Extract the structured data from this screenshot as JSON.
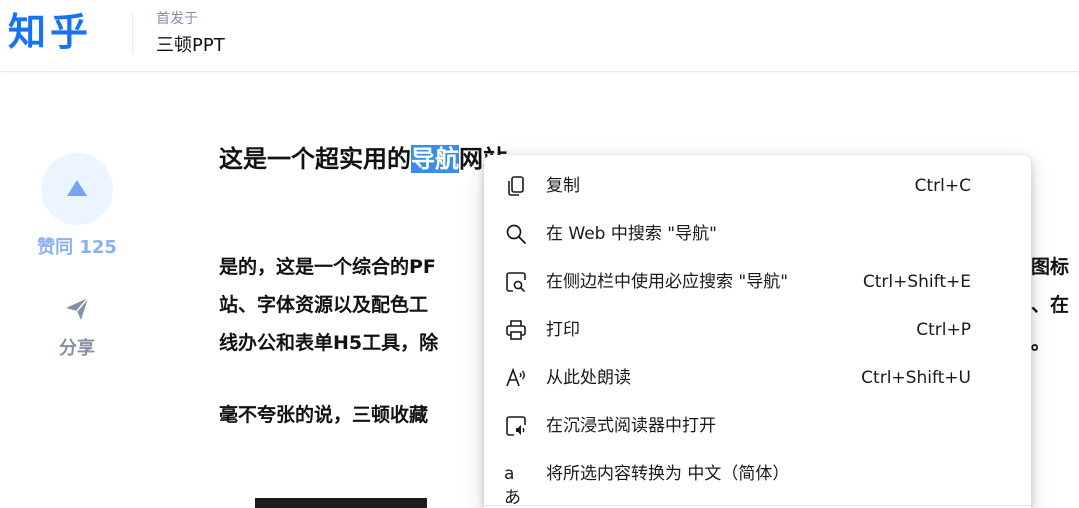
{
  "header": {
    "logo": "知乎",
    "published_label": "首发于",
    "column_name": "三顿PPT"
  },
  "side_actions": {
    "vote_label": "赞同 125",
    "share_label": "分享"
  },
  "article": {
    "title_before": "这是一个超实用的",
    "title_highlight": "导航",
    "title_after": "网站",
    "paragraphs": [
      "是的，这是一个综合的PF",
      "站、字体资源以及配色工",
      "线办公和表单H5工具，除",
      "毫不夸张的说，三顿收藏"
    ],
    "paragraph_tails": [
      "图标",
      "、在",
      "。"
    ]
  },
  "context_menu": {
    "items": [
      {
        "icon": "copy-icon",
        "label": "复制",
        "shortcut": "Ctrl+C"
      },
      {
        "icon": "search-icon",
        "label": "在 Web 中搜索 \"导航\"",
        "shortcut": ""
      },
      {
        "icon": "sidebar-search-icon",
        "label": "在侧边栏中使用必应搜索 \"导航\"",
        "shortcut": "Ctrl+Shift+E"
      },
      {
        "icon": "print-icon",
        "label": "打印",
        "shortcut": "Ctrl+P"
      },
      {
        "icon": "read-aloud-icon",
        "label": "从此处朗读",
        "shortcut": "Ctrl+Shift+U"
      },
      {
        "icon": "immersive-reader-icon",
        "label": "在沉浸式阅读器中打开",
        "shortcut": ""
      },
      {
        "icon": "translate-icon",
        "label": "将所选内容转换为 中文（简体）",
        "shortcut": ""
      }
    ]
  },
  "colors": {
    "brand": "#1772f6",
    "highlight": "#3a8ee6",
    "vote_bg": "#ebf5ff",
    "muted": "#8590a6"
  }
}
